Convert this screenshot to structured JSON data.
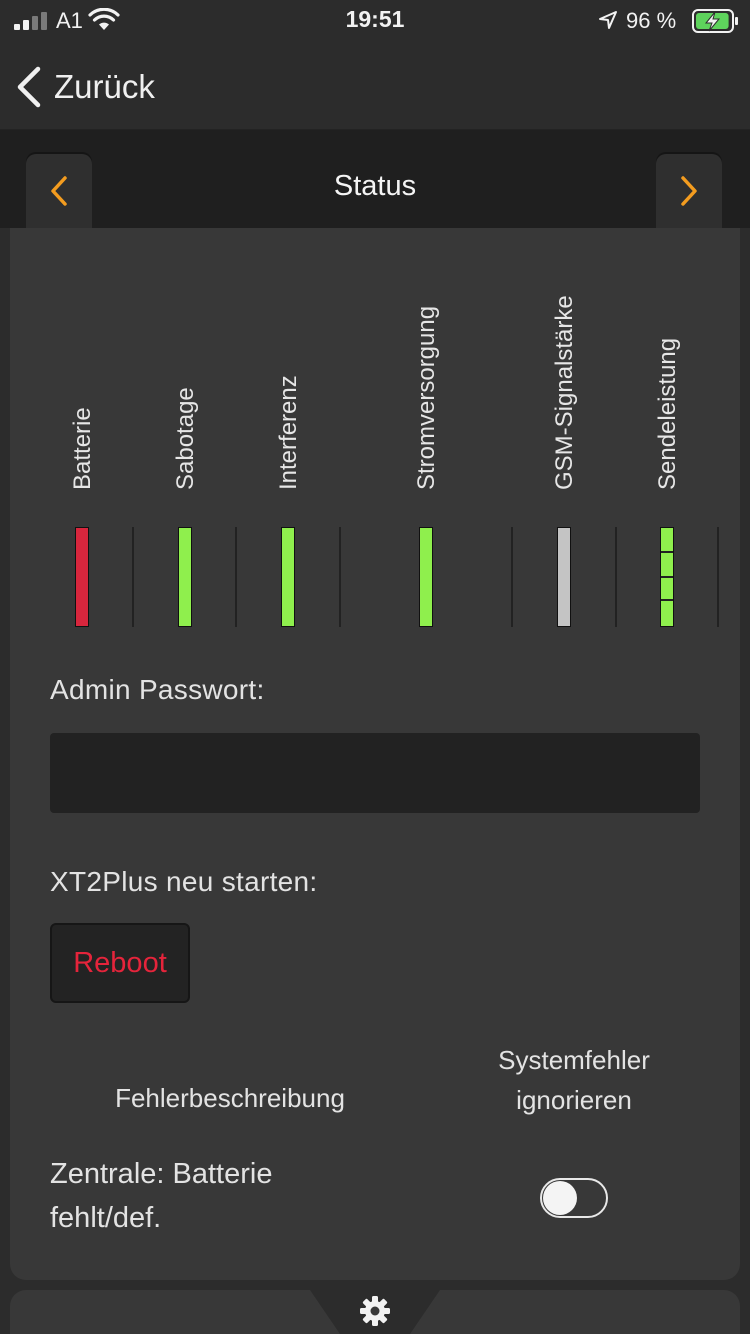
{
  "status_bar": {
    "carrier": "A1",
    "time": "19:51",
    "battery_percent": "96 %",
    "battery_level": 0.96,
    "signal_bars": 2,
    "signal_bars_total": 4,
    "icons": [
      "cellular-signal-icon",
      "wifi-icon",
      "location-arrow-icon",
      "battery-charging-icon"
    ]
  },
  "nav": {
    "back_label": "Zurück",
    "back_icon": "chevron-left-icon"
  },
  "tab_header": {
    "title": "Status",
    "prev_icon": "chevron-left-icon",
    "next_icon": "chevron-right-icon",
    "accent_color": "#f39c1f"
  },
  "indicators": [
    {
      "label": "Batterie",
      "state": "error",
      "color": "#d8263d"
    },
    {
      "label": "Sabotage",
      "state": "ok",
      "color": "#8fef4d"
    },
    {
      "label": "Interferenz",
      "state": "ok",
      "color": "#8fef4d"
    },
    {
      "label": "Stromversorgung",
      "state": "ok",
      "color": "#8fef4d"
    },
    {
      "label": "GSM-Signalstärke",
      "state": "inactive",
      "color": "#c4c4c4"
    },
    {
      "label": "Sendeleistung",
      "state": "ok",
      "color": "#8fef4d",
      "segments": 4
    }
  ],
  "admin": {
    "label": "Admin Passwort:",
    "value": "",
    "placeholder": ""
  },
  "restart": {
    "label": "XT2Plus neu starten:",
    "button_label": "Reboot",
    "button_color": "#e5243b"
  },
  "errors": {
    "col_description": "Fehlerbeschreibung",
    "col_ignore": "Systemfehler ignorieren",
    "rows": [
      {
        "description": "Zentrale: Batterie fehlt/def.",
        "ignored": false
      }
    ]
  },
  "bottom": {
    "icon": "gear-icon"
  }
}
